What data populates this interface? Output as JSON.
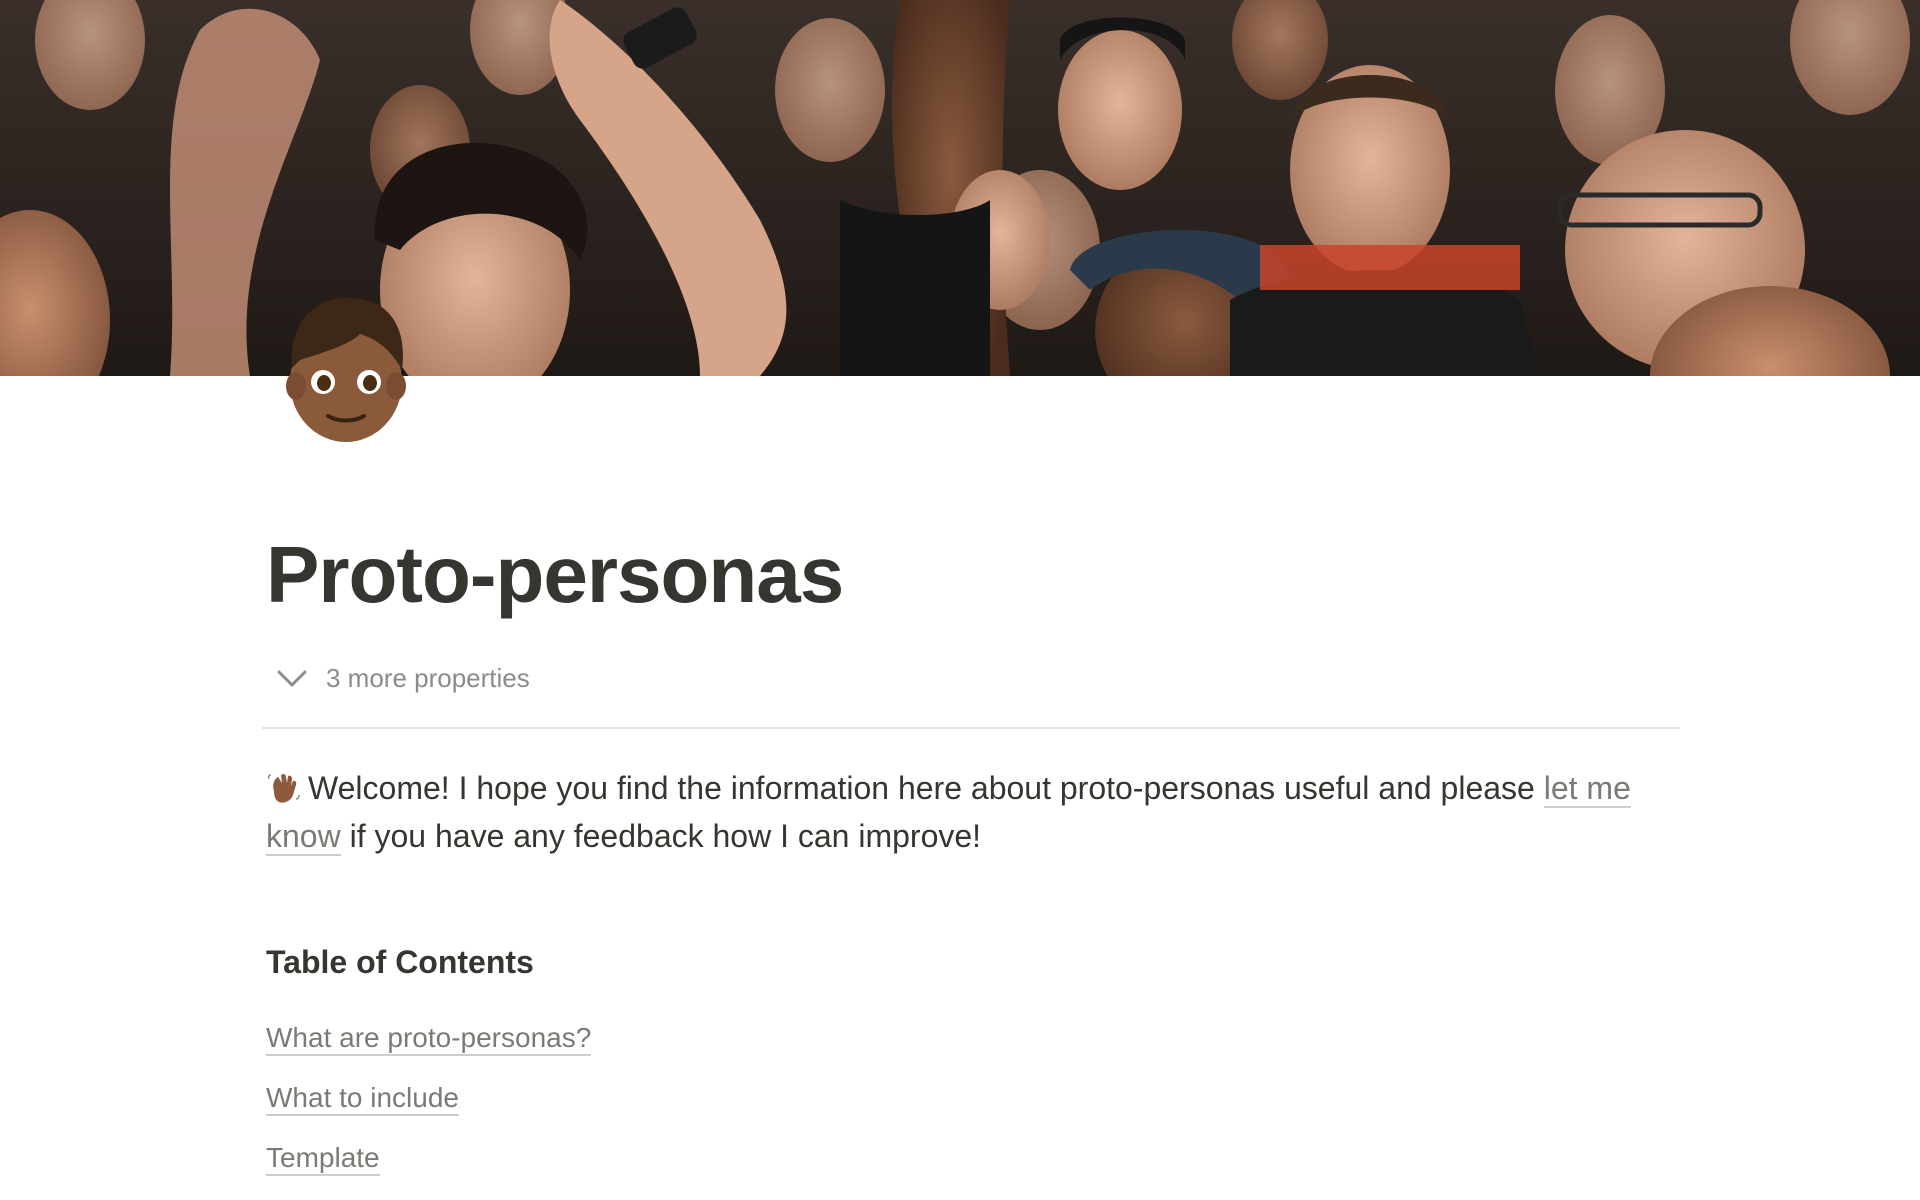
{
  "cover": {
    "description_icon": "crowd-cover-image"
  },
  "page_icon": "person-emoji-icon",
  "page": {
    "title": "Proto-personas",
    "properties_toggle": "3 more properties"
  },
  "welcome": {
    "icon": "waving-hand-icon",
    "text_before": "Welcome! I hope you find the information here about proto-personas useful and please ",
    "link_text": "let me know",
    "text_after": " if you have any feedback how I can improve!"
  },
  "toc": {
    "heading": "Table of Contents",
    "items": [
      {
        "label": "What are proto-personas?"
      },
      {
        "label": "What to include"
      },
      {
        "label": "Template"
      }
    ]
  },
  "colors": {
    "text": "#37352f",
    "muted": "#8c8b87",
    "link": "#7d7a75",
    "divider": "#e6e5e3"
  }
}
